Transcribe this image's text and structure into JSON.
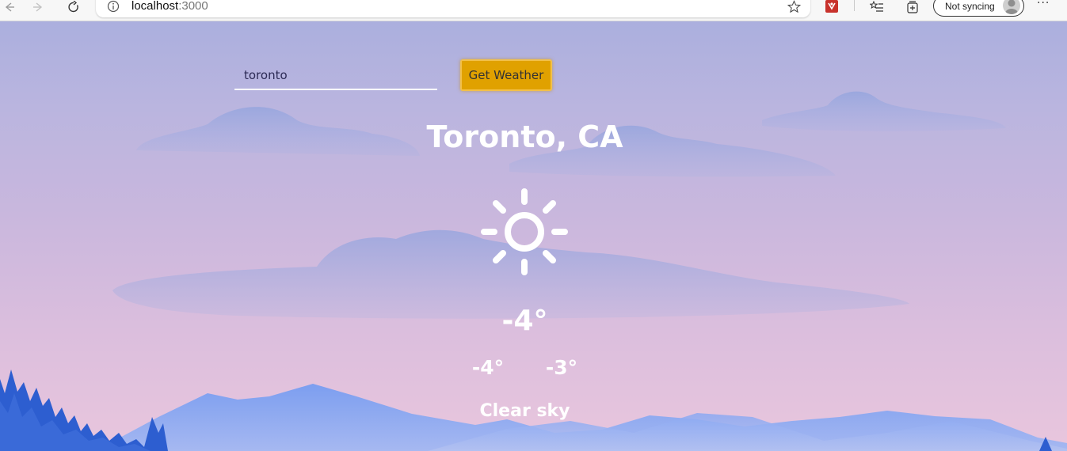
{
  "browser": {
    "url_host": "localhost",
    "url_port": ":3000",
    "sync_label": "Not syncing",
    "more_label": "···"
  },
  "app": {
    "search": {
      "value": "toronto",
      "placeholder": ""
    },
    "button_label": "Get Weather",
    "city": "Toronto, CA",
    "icon": "sun-icon",
    "temperature": "-4°",
    "temp_min": "-4°",
    "temp_max": "-3°",
    "description": "Clear sky"
  },
  "colors": {
    "button": "#e0a100",
    "sky_top": "#abafde",
    "sky_bottom": "#e9c6dd",
    "mountain": "#7fa2ee",
    "trees": "#2d5ed0"
  }
}
